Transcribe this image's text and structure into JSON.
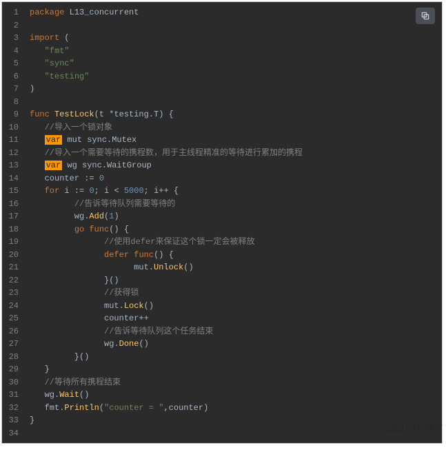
{
  "language": "go",
  "copy_icon": "copy-icon",
  "watermark": "@51CTO博客",
  "lines": [
    {
      "n": 1,
      "tokens": [
        [
          "kw",
          "package"
        ],
        [
          "plain",
          " L13_concurrent"
        ]
      ]
    },
    {
      "n": 2,
      "tokens": []
    },
    {
      "n": 3,
      "tokens": [
        [
          "kw",
          "import"
        ],
        [
          "plain",
          " ("
        ]
      ]
    },
    {
      "n": 4,
      "tokens": [
        [
          "plain",
          "   "
        ],
        [
          "str",
          "\"fmt\""
        ]
      ]
    },
    {
      "n": 5,
      "tokens": [
        [
          "plain",
          "   "
        ],
        [
          "str",
          "\"sync\""
        ]
      ]
    },
    {
      "n": 6,
      "tokens": [
        [
          "plain",
          "   "
        ],
        [
          "str",
          "\"testing\""
        ]
      ]
    },
    {
      "n": 7,
      "tokens": [
        [
          "plain",
          ")"
        ]
      ]
    },
    {
      "n": 8,
      "tokens": []
    },
    {
      "n": 9,
      "tokens": [
        [
          "kw",
          "func"
        ],
        [
          "plain",
          " "
        ],
        [
          "func",
          "TestLock"
        ],
        [
          "plain",
          "(t *testing.T) {"
        ]
      ]
    },
    {
      "n": 10,
      "tokens": [
        [
          "plain",
          "   "
        ],
        [
          "comment",
          "//导入一个锁对象"
        ]
      ]
    },
    {
      "n": 11,
      "tokens": [
        [
          "plain",
          "   "
        ],
        [
          "var",
          "var"
        ],
        [
          "plain",
          " mut sync.Mutex"
        ]
      ]
    },
    {
      "n": 12,
      "tokens": [
        [
          "plain",
          "   "
        ],
        [
          "comment",
          "//导入一个需要等待的携程数，用于主线程精准的等待进行累加的携程"
        ]
      ]
    },
    {
      "n": 13,
      "tokens": [
        [
          "plain",
          "   "
        ],
        [
          "var",
          "var"
        ],
        [
          "plain",
          " wg sync.WaitGroup"
        ]
      ]
    },
    {
      "n": 14,
      "tokens": [
        [
          "plain",
          "   counter := "
        ],
        [
          "num",
          "0"
        ]
      ]
    },
    {
      "n": 15,
      "tokens": [
        [
          "plain",
          "   "
        ],
        [
          "kw",
          "for"
        ],
        [
          "plain",
          " i := "
        ],
        [
          "num",
          "0"
        ],
        [
          "plain",
          "; i < "
        ],
        [
          "num",
          "5000"
        ],
        [
          "plain",
          "; i++ {"
        ]
      ]
    },
    {
      "n": 16,
      "tokens": [
        [
          "plain",
          "         "
        ],
        [
          "comment",
          "//告诉等待队列需要等待的"
        ]
      ]
    },
    {
      "n": 17,
      "tokens": [
        [
          "plain",
          "         wg."
        ],
        [
          "func",
          "Add"
        ],
        [
          "plain",
          "("
        ],
        [
          "num",
          "1"
        ],
        [
          "plain",
          ")"
        ]
      ]
    },
    {
      "n": 18,
      "tokens": [
        [
          "plain",
          "         "
        ],
        [
          "kw",
          "go"
        ],
        [
          "plain",
          " "
        ],
        [
          "kw",
          "func"
        ],
        [
          "plain",
          "() {"
        ]
      ]
    },
    {
      "n": 19,
      "tokens": [
        [
          "plain",
          "               "
        ],
        [
          "comment",
          "//使用defer来保证这个锁一定会被释放"
        ]
      ]
    },
    {
      "n": 20,
      "tokens": [
        [
          "plain",
          "               "
        ],
        [
          "kw",
          "defer"
        ],
        [
          "plain",
          " "
        ],
        [
          "kw",
          "func"
        ],
        [
          "plain",
          "() {"
        ]
      ]
    },
    {
      "n": 21,
      "tokens": [
        [
          "plain",
          "                     mut."
        ],
        [
          "func",
          "Unlock"
        ],
        [
          "plain",
          "()"
        ]
      ]
    },
    {
      "n": 22,
      "tokens": [
        [
          "plain",
          "               }()"
        ]
      ]
    },
    {
      "n": 23,
      "tokens": [
        [
          "plain",
          "               "
        ],
        [
          "comment",
          "//获得锁"
        ]
      ]
    },
    {
      "n": 24,
      "tokens": [
        [
          "plain",
          "               mut."
        ],
        [
          "func",
          "Lock"
        ],
        [
          "plain",
          "()"
        ]
      ]
    },
    {
      "n": 25,
      "tokens": [
        [
          "plain",
          "               counter++"
        ]
      ]
    },
    {
      "n": 26,
      "tokens": [
        [
          "plain",
          "               "
        ],
        [
          "comment",
          "//告诉等待队列这个任务结束"
        ]
      ]
    },
    {
      "n": 27,
      "tokens": [
        [
          "plain",
          "               wg."
        ],
        [
          "func",
          "Done"
        ],
        [
          "plain",
          "()"
        ]
      ]
    },
    {
      "n": 28,
      "tokens": [
        [
          "plain",
          "         }()"
        ]
      ]
    },
    {
      "n": 29,
      "tokens": [
        [
          "plain",
          "   }"
        ]
      ]
    },
    {
      "n": 30,
      "tokens": [
        [
          "plain",
          "   "
        ],
        [
          "comment",
          "//等待所有携程结束"
        ]
      ]
    },
    {
      "n": 31,
      "tokens": [
        [
          "plain",
          "   wg."
        ],
        [
          "func",
          "Wait"
        ],
        [
          "plain",
          "()"
        ]
      ]
    },
    {
      "n": 32,
      "tokens": [
        [
          "plain",
          "   fmt."
        ],
        [
          "func",
          "Println"
        ],
        [
          "plain",
          "("
        ],
        [
          "str",
          "\"counter = \""
        ],
        [
          "plain",
          ",counter)"
        ]
      ]
    },
    {
      "n": 33,
      "tokens": [
        [
          "plain",
          "}"
        ]
      ]
    },
    {
      "n": 34,
      "tokens": []
    }
  ]
}
